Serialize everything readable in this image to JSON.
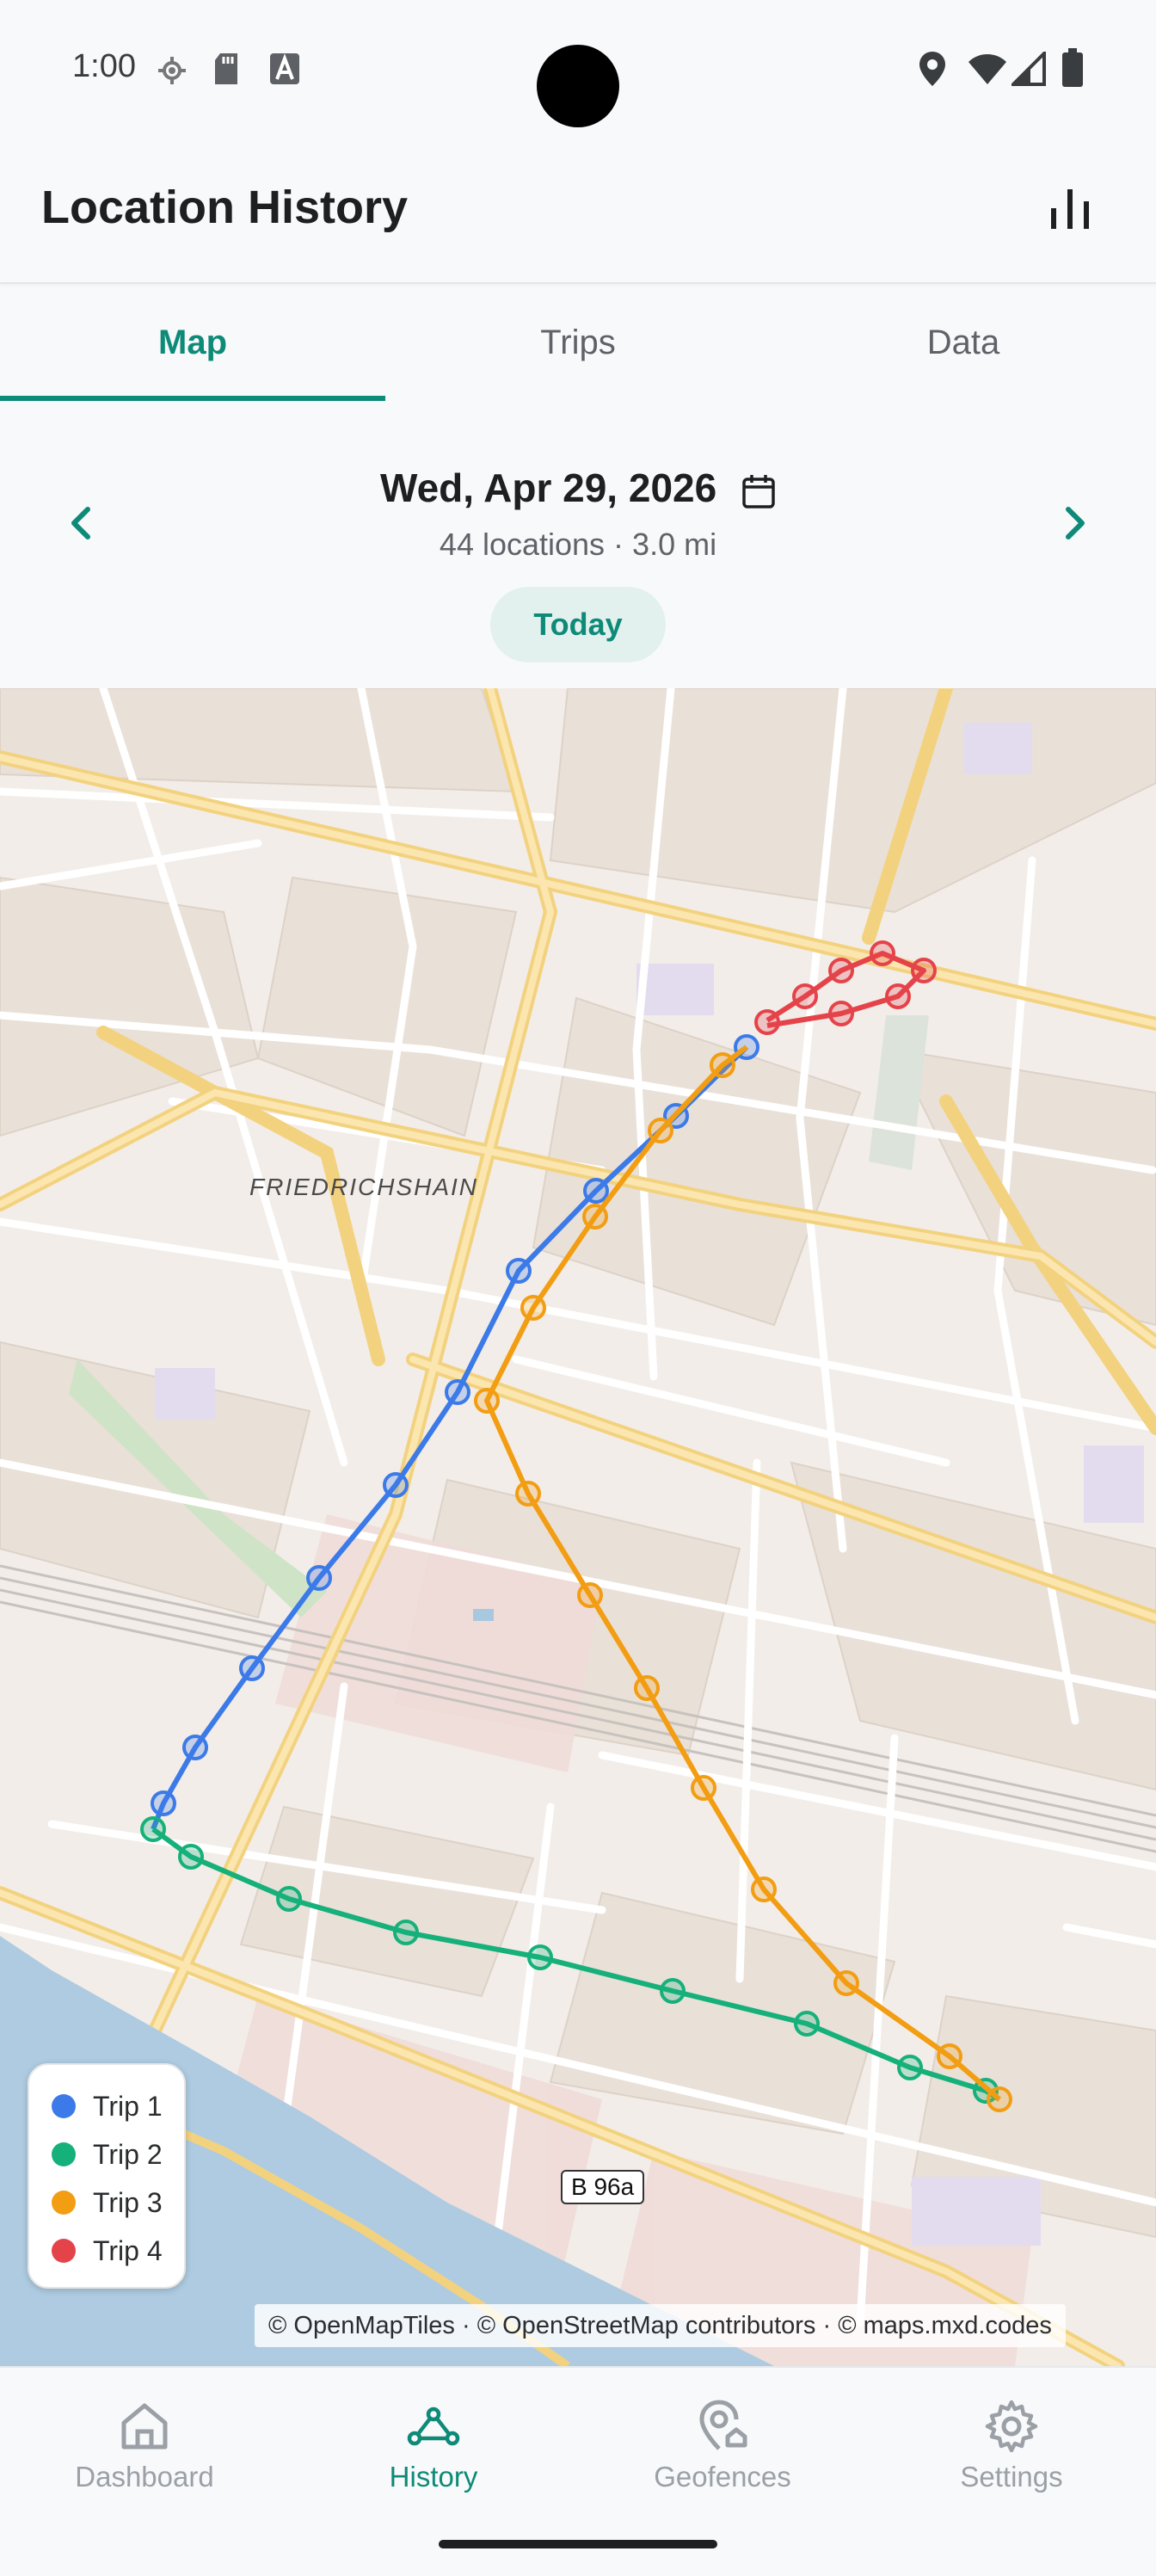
{
  "status_bar": {
    "time": "1:00"
  },
  "app_bar": {
    "title": "Location History",
    "stats_icon": "bar-chart-icon"
  },
  "tabs": [
    {
      "label": "Map",
      "active": true
    },
    {
      "label": "Trips",
      "active": false
    },
    {
      "label": "Data",
      "active": false
    }
  ],
  "date_nav": {
    "date": "Wed, Apr 29, 2026",
    "summary": "44 locations · 3.0 mi",
    "today_label": "Today"
  },
  "map": {
    "place_label": "FRIEDRICHSHAIN",
    "road_label": "B 96a",
    "attribution": "© OpenMapTiles · © OpenStreetMap contributors · © maps.mxd.codes",
    "legend": [
      {
        "label": "Trip 1",
        "color": "#3b7ae8"
      },
      {
        "label": "Trip 2",
        "color": "#16b07a"
      },
      {
        "label": "Trip 3",
        "color": "#f29d12"
      },
      {
        "label": "Trip 4",
        "color": "#e5434a"
      }
    ]
  },
  "bottom_nav": [
    {
      "label": "Dashboard",
      "icon": "home-icon",
      "active": false
    },
    {
      "label": "History",
      "icon": "route-icon",
      "active": true
    },
    {
      "label": "Geofences",
      "icon": "geofence-icon",
      "active": false
    },
    {
      "label": "Settings",
      "icon": "gear-icon",
      "active": false
    }
  ],
  "colors": {
    "accent": "#0e8a78"
  }
}
